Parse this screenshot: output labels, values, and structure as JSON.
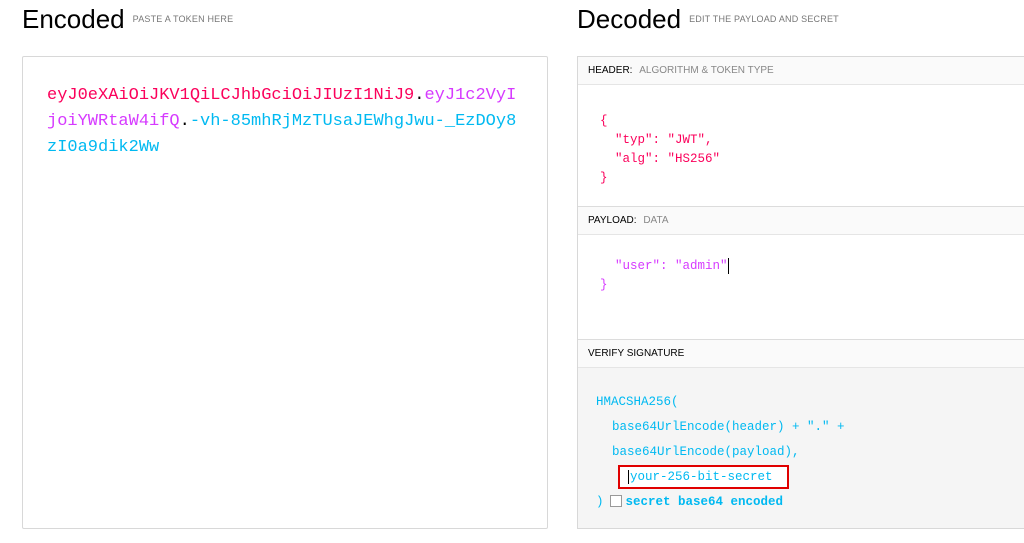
{
  "encoded": {
    "title": "Encoded",
    "subtitle": "PASTE A TOKEN HERE",
    "token_header": "eyJ0eXAiOiJKV1QiLCJhbGciOiJIUzI1NiJ9",
    "token_payload": "eyJ1c2VyIjoiYWRtaW4ifQ",
    "token_signature": "-vh-85mhRjMzTUsaJEWhgJwu-_EzDOy8zI0a9dik2Ww",
    "dot": "."
  },
  "decoded": {
    "title": "Decoded",
    "subtitle": "EDIT THE PAYLOAD AND SECRET",
    "header_section": {
      "label": "HEADER:",
      "hint": "ALGORITHM & TOKEN TYPE",
      "open": "{",
      "line1": "  \"typ\": \"JWT\",",
      "line2": "  \"alg\": \"HS256\"",
      "close": "}"
    },
    "payload_section": {
      "label": "PAYLOAD:",
      "hint": "DATA",
      "line1": "  \"user\": \"admin\"",
      "close": "}"
    },
    "verify_section": {
      "label": "VERIFY SIGNATURE",
      "fn_open": "HMACSHA256(",
      "arg1": "base64UrlEncode(header) + \".\" +",
      "arg2": "base64UrlEncode(payload),",
      "secret_value": "your-256-bit-secret",
      "fn_close": ")",
      "base64_label": "secret base64 encoded"
    }
  },
  "colors": {
    "header": "#fb015b",
    "payload": "#d63aff",
    "signature": "#00b9f1",
    "highlight_box": "#e00000"
  }
}
